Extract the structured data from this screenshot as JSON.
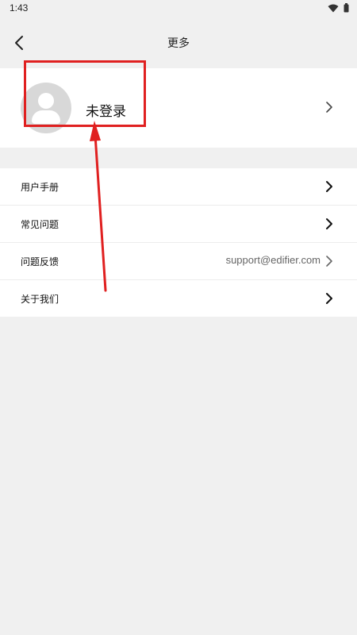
{
  "status_bar": {
    "time": "1:43",
    "icons": [
      "wifi-icon",
      "battery-icon"
    ]
  },
  "header": {
    "back_icon": "chevron-left-icon",
    "title": "更多"
  },
  "profile": {
    "avatar_icon": "user-avatar-icon",
    "name": "未登录",
    "chevron_icon": "chevron-right-icon"
  },
  "menu": {
    "items": [
      {
        "label": "用户手册",
        "value": ""
      },
      {
        "label": "常见问题",
        "value": ""
      },
      {
        "label": "问题反馈",
        "value": "support@edifier.com"
      },
      {
        "label": "关于我们",
        "value": ""
      }
    ]
  },
  "colors": {
    "background": "#f0f0f0",
    "card": "#ffffff",
    "annotation_red": "#e02020",
    "avatar_gray": "#d8d8d8"
  }
}
